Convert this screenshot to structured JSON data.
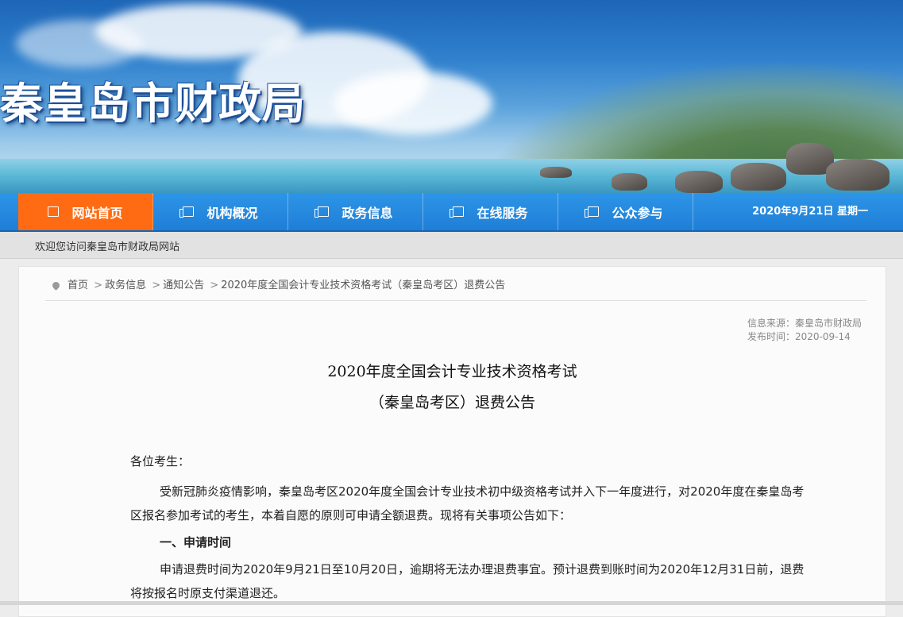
{
  "site": {
    "title": "秦皇岛市财政局"
  },
  "nav": {
    "items": [
      {
        "label": "网站首页",
        "icon": "window-icon",
        "active": true
      },
      {
        "label": "机构概况",
        "icon": "document-icon"
      },
      {
        "label": "政务信息",
        "icon": "document-icon"
      },
      {
        "label": "在线服务",
        "icon": "document-icon"
      },
      {
        "label": "公众参与",
        "icon": "document-icon"
      }
    ],
    "date": "2020年9月21日  星期一"
  },
  "welcome": "欢迎您访问秦皇岛市财政局网站",
  "breadcrumb": {
    "items": [
      "首页",
      "政务信息",
      "通知公告"
    ],
    "current": "2020年度全国会计专业技术资格考试（秦皇岛考区）退费公告"
  },
  "meta": {
    "source": "信息来源：秦皇岛市财政局",
    "date": "发布时间：2020-09-14"
  },
  "article": {
    "title_line1": "2020年度全国会计专业技术资格考试",
    "title_line2": "（秦皇岛考区）退费公告",
    "salutation": "各位考生：",
    "para1": "受新冠肺炎疫情影响，秦皇岛考区2020年度全国会计专业技术初中级资格考试并入下一年度进行，对2020年度在秦皇岛考区报名参加考试的考生，本着自愿的原则可申请全额退费。现将有关事项公告如下：",
    "heading1": "一、申请时间",
    "para2": "申请退费时间为2020年9月21日至10月20日，逾期将无法办理退费事宜。预计退费到账时间为2020年12月31日前，退费将按报名时原支付渠道退还。"
  },
  "colors": {
    "nav_blue": "#1f7ed6",
    "nav_active": "#ff6b12"
  }
}
